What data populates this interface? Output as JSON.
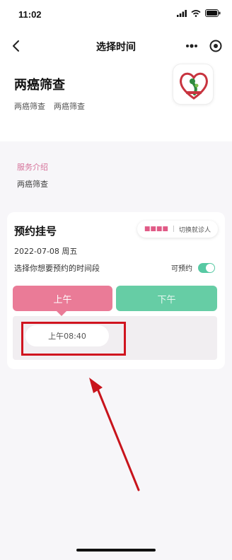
{
  "status_bar": {
    "time": "11:02"
  },
  "nav": {
    "title": "选择时间"
  },
  "header": {
    "title": "两癌筛查",
    "subtitle_1": "两癌筛查",
    "subtitle_2": "两癌筛查"
  },
  "intro": {
    "label": "服务介绍",
    "text": "两癌筛查"
  },
  "booking": {
    "title": "预约挂号",
    "visitor_name": "■■■■",
    "switch_label": "切换就诊人",
    "date": "2022-07-08 周五",
    "prompt": "选择你想要预约的时间段",
    "available_label": "可预约",
    "available_on": true,
    "tab_am": "上午",
    "tab_pm": "下午",
    "slot": "上午08:40"
  },
  "colors": {
    "accent_pink": "#ea7b97",
    "accent_green": "#66cda5",
    "label_pink": "#d6729a",
    "annotation_red": "#d0141f"
  }
}
